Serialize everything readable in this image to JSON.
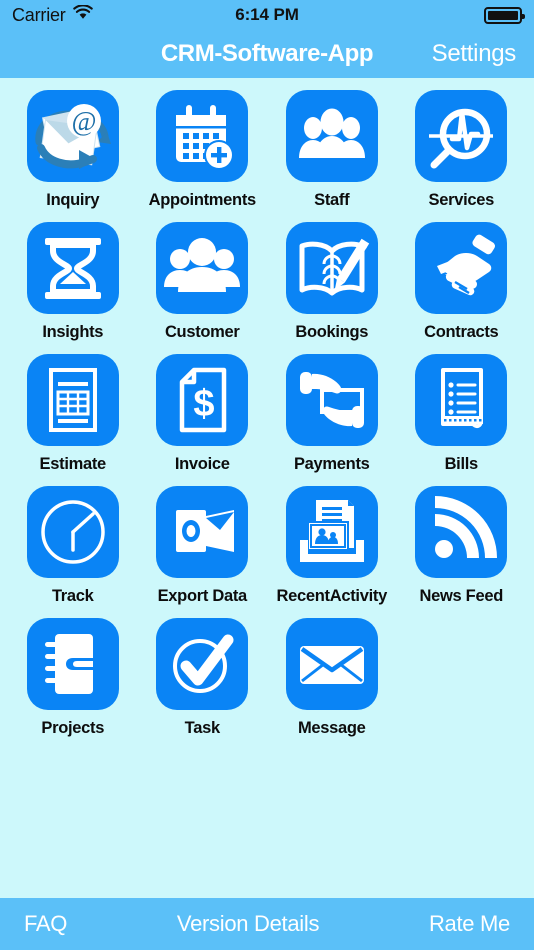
{
  "theme": {
    "page_background": "#cdf8fb",
    "bar_background": "#5bc0f8",
    "tile_background": "#0a84f5",
    "tile_glyph": "#ffffff",
    "label_color": "#0d0d0d",
    "bar_text": "#ffffff"
  },
  "status_bar": {
    "carrier": "Carrier",
    "wifi_icon": "wifi-icon",
    "time": "6:14 PM",
    "battery_icon": "battery-full-icon",
    "battery_level": 100
  },
  "nav_bar": {
    "title": "CRM-Software-App",
    "settings_label": "Settings"
  },
  "grid": {
    "columns": 4,
    "items": [
      {
        "label": "Inquiry",
        "icon": "email-at-envelope-icon"
      },
      {
        "label": "Appointments",
        "icon": "calendar-plus-icon"
      },
      {
        "label": "Staff",
        "icon": "three-people-icon"
      },
      {
        "label": "Services",
        "icon": "magnifier-pulse-icon"
      },
      {
        "label": "Insights",
        "icon": "hourglass-icon"
      },
      {
        "label": "Customer",
        "icon": "customer-group-icon"
      },
      {
        "label": "Bookings",
        "icon": "open-book-pen-icon"
      },
      {
        "label": "Contracts",
        "icon": "handshake-icon"
      },
      {
        "label": "Estimate",
        "icon": "document-table-icon"
      },
      {
        "label": "Invoice",
        "icon": "document-dollar-icon"
      },
      {
        "label": "Payments",
        "icon": "hands-card-icon"
      },
      {
        "label": "Bills",
        "icon": "receipt-list-icon"
      },
      {
        "label": "Track",
        "icon": "clock-icon"
      },
      {
        "label": "Export Data",
        "icon": "outlook-envelope-icon"
      },
      {
        "label": "RecentActivity",
        "icon": "document-photo-tray-icon"
      },
      {
        "label": "News Feed",
        "icon": "rss-feed-icon"
      },
      {
        "label": "Projects",
        "icon": "notebook-binder-icon"
      },
      {
        "label": "Task",
        "icon": "check-circle-icon"
      },
      {
        "label": "Message",
        "icon": "envelope-icon"
      }
    ]
  },
  "toolbar": {
    "faq_label": "FAQ",
    "version_label": "Version Details",
    "rate_label": "Rate Me"
  }
}
